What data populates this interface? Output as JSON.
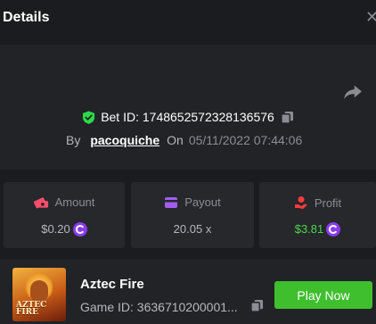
{
  "header": {
    "title": "Details",
    "close_glyph": "✕"
  },
  "bet": {
    "id_text": "Bet ID: 1748652572328136576",
    "by_label": "By",
    "username": "pacoquiche",
    "on_label": "On",
    "datetime": "05/11/2022 07:44:06"
  },
  "stats": {
    "amount": {
      "label": "Amount",
      "value": "$0.20",
      "icon": "money-icon"
    },
    "payout": {
      "label": "Payout",
      "value": "20.05 x",
      "icon": "wallet-icon"
    },
    "profit": {
      "label": "Profit",
      "value": "$3.81",
      "icon": "hand-coin-icon"
    }
  },
  "game": {
    "name": "Aztec Fire",
    "id_text": "Game ID: 3636710200001...",
    "thumb_logo_line1": "AZTEC",
    "thumb_logo_line2": "FIRE",
    "play_label": "Play Now"
  },
  "colors": {
    "accent_green": "#3fbf2e",
    "profit_green": "#4fd649",
    "coin_purple": "#8b3cf0",
    "amount_pink": "#ff4d6d",
    "payout_purple": "#a35cf0",
    "profit_red": "#ff3b3b",
    "shield_green": "#2bd94a"
  }
}
